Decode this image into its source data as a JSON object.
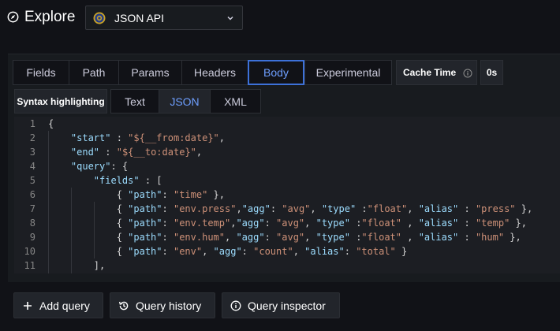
{
  "header": {
    "title": "Explore",
    "datasource": {
      "name": "JSON API"
    }
  },
  "query_tabs": [
    {
      "label": "Fields",
      "active": false
    },
    {
      "label": "Path",
      "active": false
    },
    {
      "label": "Params",
      "active": false
    },
    {
      "label": "Headers",
      "active": false
    },
    {
      "label": "Body",
      "active": true
    },
    {
      "label": "Experimental",
      "active": false
    }
  ],
  "cache": {
    "label": "Cache Time",
    "value": "0s"
  },
  "syntax": {
    "label": "Syntax highlighting",
    "options": [
      {
        "label": "Text",
        "active": false
      },
      {
        "label": "JSON",
        "active": true
      },
      {
        "label": "XML",
        "active": false
      }
    ]
  },
  "editor": {
    "line_numbers": [
      "1",
      "2",
      "3",
      "4",
      "5",
      "6",
      "7",
      "8",
      "9",
      "10",
      "11"
    ],
    "lines": [
      "{",
      "    \"start\" : \"${__from:date}\",",
      "    \"end\" : \"${__to:date}\",",
      "    \"query\": {",
      "        \"fields\" : [",
      "            { \"path\": \"time\" },",
      "            { \"path\": \"env.press\",\"agg\": \"avg\", \"type\" :\"float\", \"alias\" : \"press\" },",
      "            { \"path\": \"env.temp\",\"agg\": \"avg\", \"type\" :\"float\" , \"alias\" : \"temp\" },",
      "            { \"path\": \"env.hum\", \"agg\": \"avg\", \"type\" :\"float\" , \"alias\" : \"hum\" },",
      "            { \"path\": \"env\", \"agg\": \"count\", \"alias\": \"total\" }",
      "        ],"
    ]
  },
  "actions": {
    "add_query": "Add query",
    "query_history": "Query history",
    "query_inspector": "Query inspector"
  },
  "colors": {
    "accent": "#3d71d9",
    "active_text": "#6e9fff",
    "json_key": "#9cdcfe",
    "json_string": "#ce9178"
  }
}
